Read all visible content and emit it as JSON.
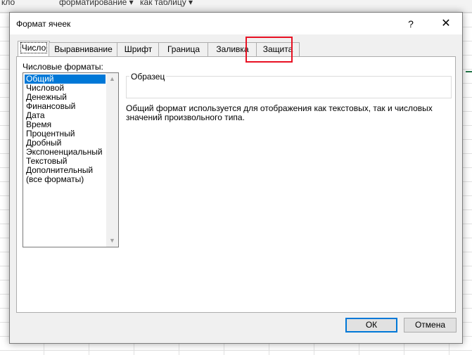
{
  "background": {
    "ribbon_items": [
      {
        "text": "кло"
      },
      {
        "text": "форматирование ▾"
      },
      {
        "text": "как таблицу ▾"
      }
    ]
  },
  "dialog": {
    "title": "Формат ячеек",
    "help_symbol": "?",
    "close_symbol": "✕",
    "tabs": [
      {
        "label": "Число",
        "active": true
      },
      {
        "label": "Выравнивание",
        "active": false
      },
      {
        "label": "Шрифт",
        "active": false
      },
      {
        "label": "Граница",
        "active": false
      },
      {
        "label": "Заливка",
        "active": false
      },
      {
        "label": "Защита",
        "active": false
      }
    ],
    "number_formats_label": "Числовые форматы:",
    "number_formats": [
      "Общий",
      "Числовой",
      "Денежный",
      "Финансовый",
      "Дата",
      "Время",
      "Процентный",
      "Дробный",
      "Экспоненциальный",
      "Текстовый",
      "Дополнительный",
      "(все форматы)"
    ],
    "selected_format": "Общий",
    "sample_label": "Образец",
    "description_line1": "Общий формат используется для отображения как текстовых, так и числовых",
    "description_line2": "значений произвольного типа.",
    "ok_label": "ОК",
    "cancel_label": "Отмена"
  },
  "colors": {
    "accent": "#0078d7",
    "highlight": "#e81123"
  }
}
